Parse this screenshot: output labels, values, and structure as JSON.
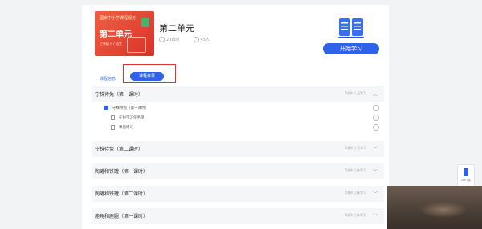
{
  "course": {
    "cover_top": "国家中小学课程服务",
    "cover_title": "第二单元",
    "cover_sub": "三年级下 / 语文",
    "title": "第二单元",
    "lessons": "23课时",
    "learners": "45人",
    "start_label": "开始学习"
  },
  "tabs": {
    "intro": "课程信息",
    "catalog": "课程目录"
  },
  "chapters": [
    {
      "title": "守株待兔（第一课时）",
      "meta": "1课时 | 已学习",
      "expanded": true
    },
    {
      "title": "守株待兔（第二课时）",
      "meta": "1课时 | 已学习",
      "expanded": false
    },
    {
      "title": "陶罐和铁罐（第一课时）",
      "meta": "1课时 | 未学习",
      "expanded": false
    },
    {
      "title": "陶罐和铁罐（第二课时）",
      "meta": "1课时 | 未学习",
      "expanded": false
    },
    {
      "title": "鹿角和鹿腿（第一课时）",
      "meta": "1课时 | 未学习",
      "expanded": false
    }
  ],
  "lesson_items": [
    {
      "label": "守株待兔（第一课时）",
      "type": "video"
    },
    {
      "label": "在线学习任务单",
      "type": "doc"
    },
    {
      "label": "课后练习",
      "type": "doc"
    }
  ],
  "side": {
    "app_label": "APP下载"
  },
  "colors": {
    "accent": "#2e63e8",
    "cover": "#e2402f",
    "highlight_box": "#e0352b"
  }
}
